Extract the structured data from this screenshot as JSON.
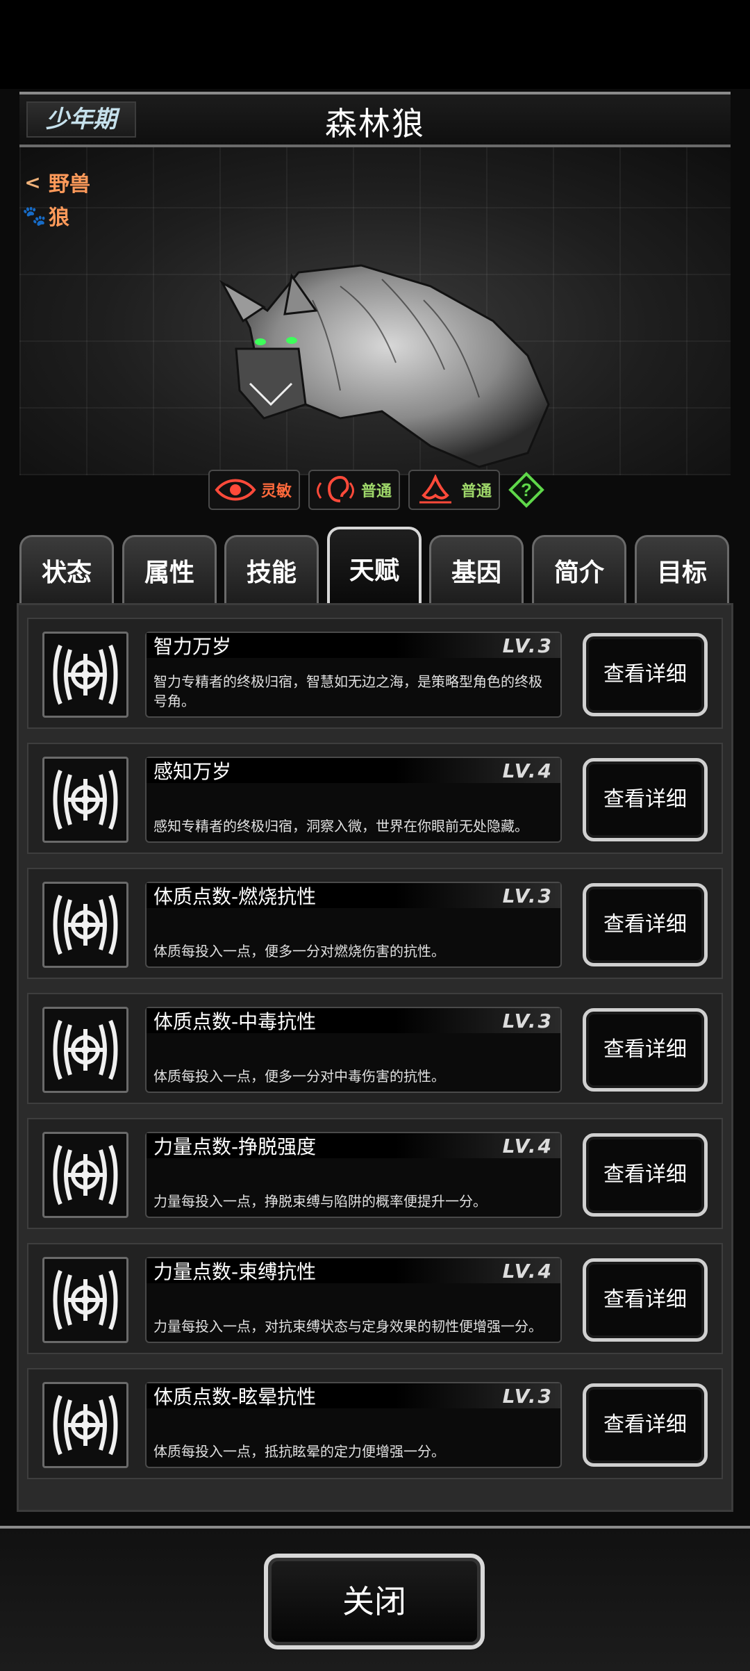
{
  "header": {
    "stage": "少年期",
    "name": "森林狼"
  },
  "tags": [
    {
      "icon": "share-icon",
      "label": "野兽"
    },
    {
      "icon": "paw-icon",
      "label": "狼"
    }
  ],
  "senses": [
    {
      "icon": "eye-icon",
      "value": "灵敏",
      "color": "#ff6a3c"
    },
    {
      "icon": "ear-icon",
      "value": "普通",
      "color": "#9fd86a"
    },
    {
      "icon": "nose-icon",
      "value": "普通",
      "color": "#9fd86a"
    }
  ],
  "help": "?",
  "tabs": [
    "状态",
    "属性",
    "技能",
    "天赋",
    "基因",
    "简介",
    "目标"
  ],
  "active_tab": "天赋",
  "talents": [
    {
      "title": "智力万岁",
      "level": "LV.3",
      "desc": "智力专精者的终极归宿，智慧如无边之海，是策略型角色的终极号角。"
    },
    {
      "title": "感知万岁",
      "level": "LV.4",
      "desc": "感知专精者的终极归宿，洞察入微，世界在你眼前无处隐藏。"
    },
    {
      "title": "体质点数-燃烧抗性",
      "level": "LV.3",
      "desc": "体质每投入一点，便多一分对燃烧伤害的抗性。"
    },
    {
      "title": "体质点数-中毒抗性",
      "level": "LV.3",
      "desc": "体质每投入一点，便多一分对中毒伤害的抗性。"
    },
    {
      "title": "力量点数-挣脱强度",
      "level": "LV.4",
      "desc": "力量每投入一点，挣脱束缚与陷阱的概率便提升一分。"
    },
    {
      "title": "力量点数-束缚抗性",
      "level": "LV.4",
      "desc": "力量每投入一点，对抗束缚状态与定身效果的韧性便增强一分。"
    },
    {
      "title": "体质点数-眩晕抗性",
      "level": "LV.3",
      "desc": "体质每投入一点，抵抗眩晕的定力便增强一分。"
    }
  ],
  "detail_label": "查看详细",
  "close_label": "关闭"
}
